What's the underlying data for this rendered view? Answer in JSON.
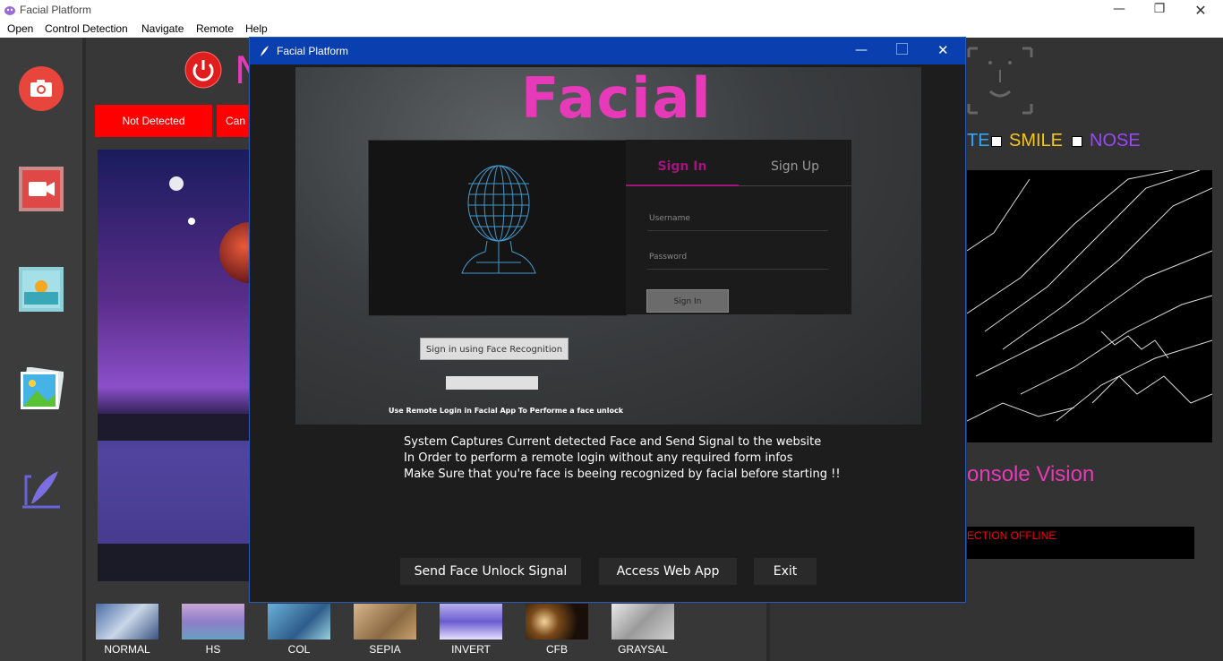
{
  "app": {
    "title": "Facial Platform",
    "menu": [
      "Open",
      "Control Detection",
      "Navigate",
      "Remote",
      "Help"
    ]
  },
  "status": {
    "detect_label": "Not Detected",
    "second_label": "Can",
    "title_initial": "N"
  },
  "right_panel": {
    "checks": [
      "TE",
      "SMILE",
      "NOSE"
    ],
    "console_title": "onsole Vision",
    "console_status": "ECTION OFFLINE"
  },
  "filters": [
    "NORMAL",
    "HS",
    "COL",
    "SEPIA",
    "INVERT",
    "CFB",
    "GRAYSAL"
  ],
  "dialog": {
    "title": "Facial Platform",
    "logo": "Facial",
    "tab_signin": "Sign In",
    "tab_signup": "Sign Up",
    "username_placeholder": "Username",
    "password_placeholder": "Password",
    "signin_button": "Sign In",
    "face_recognition_button": "Sign in using Face Recognition",
    "remote_hint": "Use Remote Login in Facial App To Performe a face unlock",
    "info_lines": [
      "System Captures Current detected Face and Send Signal to the website",
      "In Order to perform a remote login without any required form infos",
      "Make Sure that you're face is beeing recognized by facial before starting !!"
    ],
    "buttons": {
      "send": "Send Face Unlock Signal",
      "access": "Access Web App",
      "exit": "Exit"
    }
  },
  "colors": {
    "accent": "#0a3fb0",
    "logo": "#e63ab8",
    "signin_tab": "#a0167e",
    "alert": "#ff0000",
    "smile": "#f5c518",
    "nose": "#9b46ff",
    "te": "#2ea8ff"
  }
}
